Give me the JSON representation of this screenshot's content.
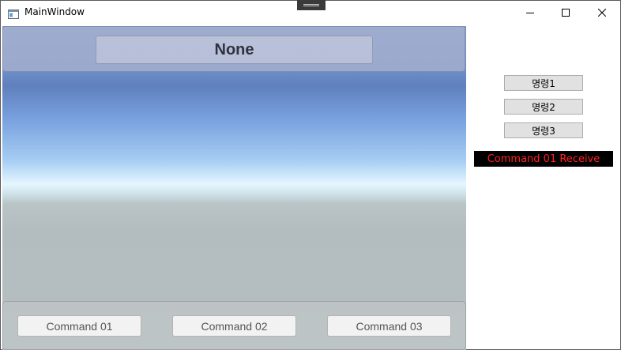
{
  "window": {
    "title": "MainWindow"
  },
  "unity_view": {
    "status_text": "None",
    "buttons": [
      {
        "label": "Command 01"
      },
      {
        "label": "Command 02"
      },
      {
        "label": "Command 03"
      }
    ]
  },
  "side_panel": {
    "buttons": [
      {
        "label": "명령1"
      },
      {
        "label": "명령2"
      },
      {
        "label": "명령3"
      }
    ],
    "received_text": "Command 01 Receive"
  },
  "colors": {
    "received_text": "#ff2020",
    "received_background": "#000000",
    "side_button_background": "#e1e1e1"
  },
  "icons": [
    "window-app-icon",
    "minimize-icon",
    "maximize-icon",
    "close-icon",
    "drag-handle-icon"
  ]
}
